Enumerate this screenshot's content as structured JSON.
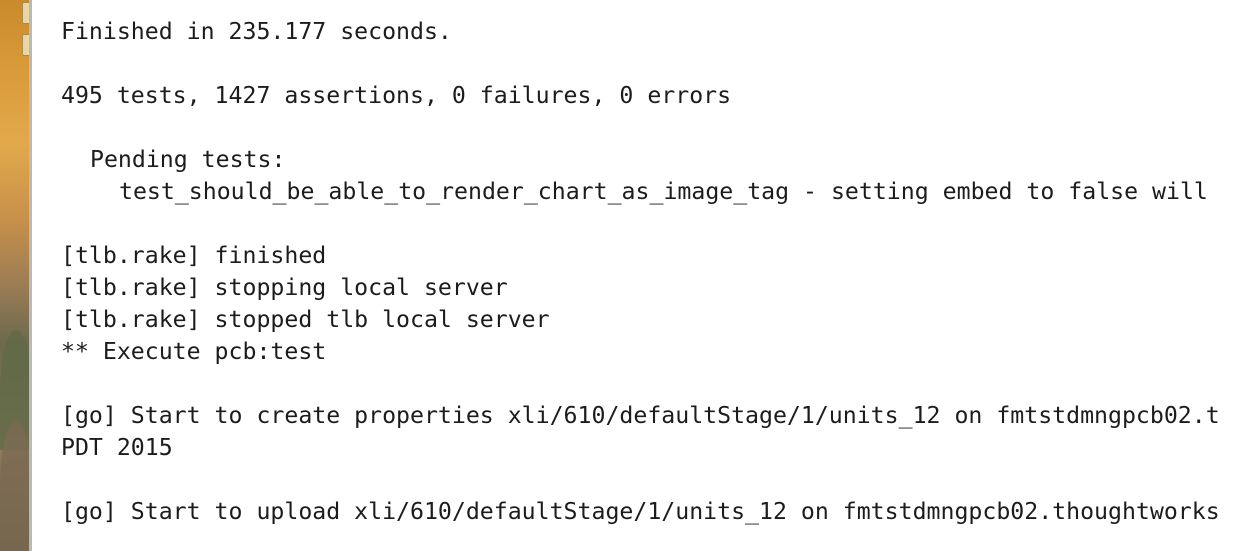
{
  "terminal": {
    "lines": {
      "finished": "Finished in 235.177 seconds.",
      "summary": "495 tests, 1427 assertions, 0 failures, 0 errors",
      "pending_header": "Pending tests:",
      "pending_item": "test_should_be_able_to_render_chart_as_image_tag - setting embed to false will",
      "tlb_finished": "[tlb.rake] finished",
      "tlb_stopping": "[tlb.rake] stopping local server",
      "tlb_stopped": "[tlb.rake] stopped tlb local server",
      "execute": "** Execute pcb:test",
      "go_create": "[go] Start to create properties xli/610/defaultStage/1/units_12 on fmtstdmngpcb02.t",
      "go_create_cont": "PDT 2015",
      "go_upload": "[go] Start to upload xli/610/defaultStage/1/units_12 on fmtstdmngpcb02.thoughtworks"
    }
  }
}
